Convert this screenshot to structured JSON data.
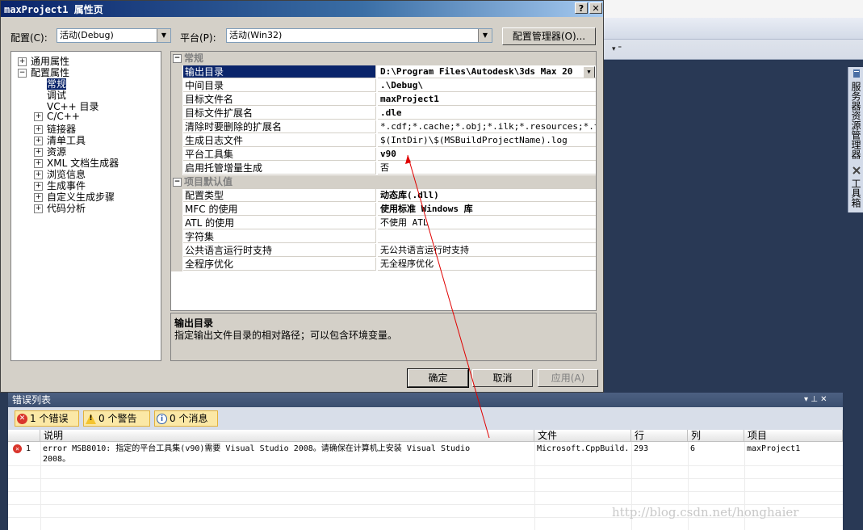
{
  "dialog": {
    "title": "maxProject1 属性页",
    "help_btn": "?",
    "close_btn": "✕",
    "config_label": "配置(C):",
    "config_value": "活动(Debug)",
    "platform_label": "平台(P):",
    "platform_value": "活动(Win32)",
    "config_manager": "配置管理器(O)..."
  },
  "tree": {
    "items": [
      {
        "label": "通用属性",
        "expander": "+",
        "level": 0
      },
      {
        "label": "配置属性",
        "expander": "−",
        "level": 0
      },
      {
        "label": "常规",
        "expander": "",
        "level": 1,
        "selected": true
      },
      {
        "label": "调试",
        "expander": "",
        "level": 1
      },
      {
        "label": "VC++ 目录",
        "expander": "",
        "level": 1
      },
      {
        "label": "C/C++",
        "expander": "+",
        "level": 1
      },
      {
        "label": "链接器",
        "expander": "+",
        "level": 1
      },
      {
        "label": "清单工具",
        "expander": "+",
        "level": 1
      },
      {
        "label": "资源",
        "expander": "+",
        "level": 1
      },
      {
        "label": "XML 文档生成器",
        "expander": "+",
        "level": 1
      },
      {
        "label": "浏览信息",
        "expander": "+",
        "level": 1
      },
      {
        "label": "生成事件",
        "expander": "+",
        "level": 1
      },
      {
        "label": "自定义生成步骤",
        "expander": "+",
        "level": 1
      },
      {
        "label": "代码分析",
        "expander": "+",
        "level": 1
      }
    ]
  },
  "grid": {
    "cat1": "常规",
    "cat2": "项目默认值",
    "general": [
      {
        "name": "输出目录",
        "value": "D:\\Program Files\\Autodesk\\3ds Max 20",
        "bold": true,
        "selected": true,
        "dropdown": true
      },
      {
        "name": "中间目录",
        "value": ".\\Debug\\",
        "bold": true
      },
      {
        "name": "目标文件名",
        "value": "maxProject1",
        "bold": true
      },
      {
        "name": "目标文件扩展名",
        "value": ".dle",
        "bold": true
      },
      {
        "name": "清除时要删除的扩展名",
        "value": "*.cdf;*.cache;*.obj;*.ilk;*.resources;*.tlb;*",
        "bold": false
      },
      {
        "name": "生成日志文件",
        "value": "$(IntDir)\\$(MSBuildProjectName).log",
        "bold": false
      },
      {
        "name": "平台工具集",
        "value": "v90",
        "bold": true
      },
      {
        "name": "启用托管增量生成",
        "value": "否",
        "bold": false
      }
    ],
    "defaults": [
      {
        "name": "配置类型",
        "value": "动态库(.dll)",
        "bold": true
      },
      {
        "name": "MFC 的使用",
        "value": "使用标准 Windows 库",
        "bold": true
      },
      {
        "name": "ATL 的使用",
        "value": "不使用 ATL",
        "bold": false
      },
      {
        "name": "字符集",
        "value": "",
        "bold": false
      },
      {
        "name": "公共语言运行时支持",
        "value": "无公共语言运行时支持",
        "bold": false
      },
      {
        "name": "全程序优化",
        "value": "无全程序优化",
        "bold": false
      }
    ]
  },
  "description": {
    "title": "输出目录",
    "text": "指定输出文件目录的相对路径；可以包含环境变量。"
  },
  "buttons": {
    "ok": "确定",
    "cancel": "取消",
    "apply": "应用(A)"
  },
  "side_tabs": {
    "server": "服务器资源管理器",
    "toolbox": "工具箱"
  },
  "errorlist": {
    "title": "错误列表",
    "controls": "▾ ⊥ ✕",
    "errors_btn": "1 个错误",
    "warnings_btn": "0 个警告",
    "messages_btn": "0 个消息",
    "columns": {
      "desc": "说明",
      "file": "文件",
      "line": "行",
      "col": "列",
      "project": "项目"
    },
    "rows": [
      {
        "num": "1",
        "desc_line1": "error MSB8010: 指定的平台工具集(v90)需要 Visual Studio 2008。请确保在计算机上安装 Visual Studio",
        "desc_line2": "2008。",
        "file": "Microsoft.CppBuild.",
        "line": "293",
        "col": "6",
        "project": "maxProject1"
      }
    ]
  },
  "watermark": "http://blog.csdn.net/honghaier",
  "colors": {
    "title_start": "#0a246a",
    "error_red": "#d9352c",
    "annotation_red": "#e00000"
  }
}
